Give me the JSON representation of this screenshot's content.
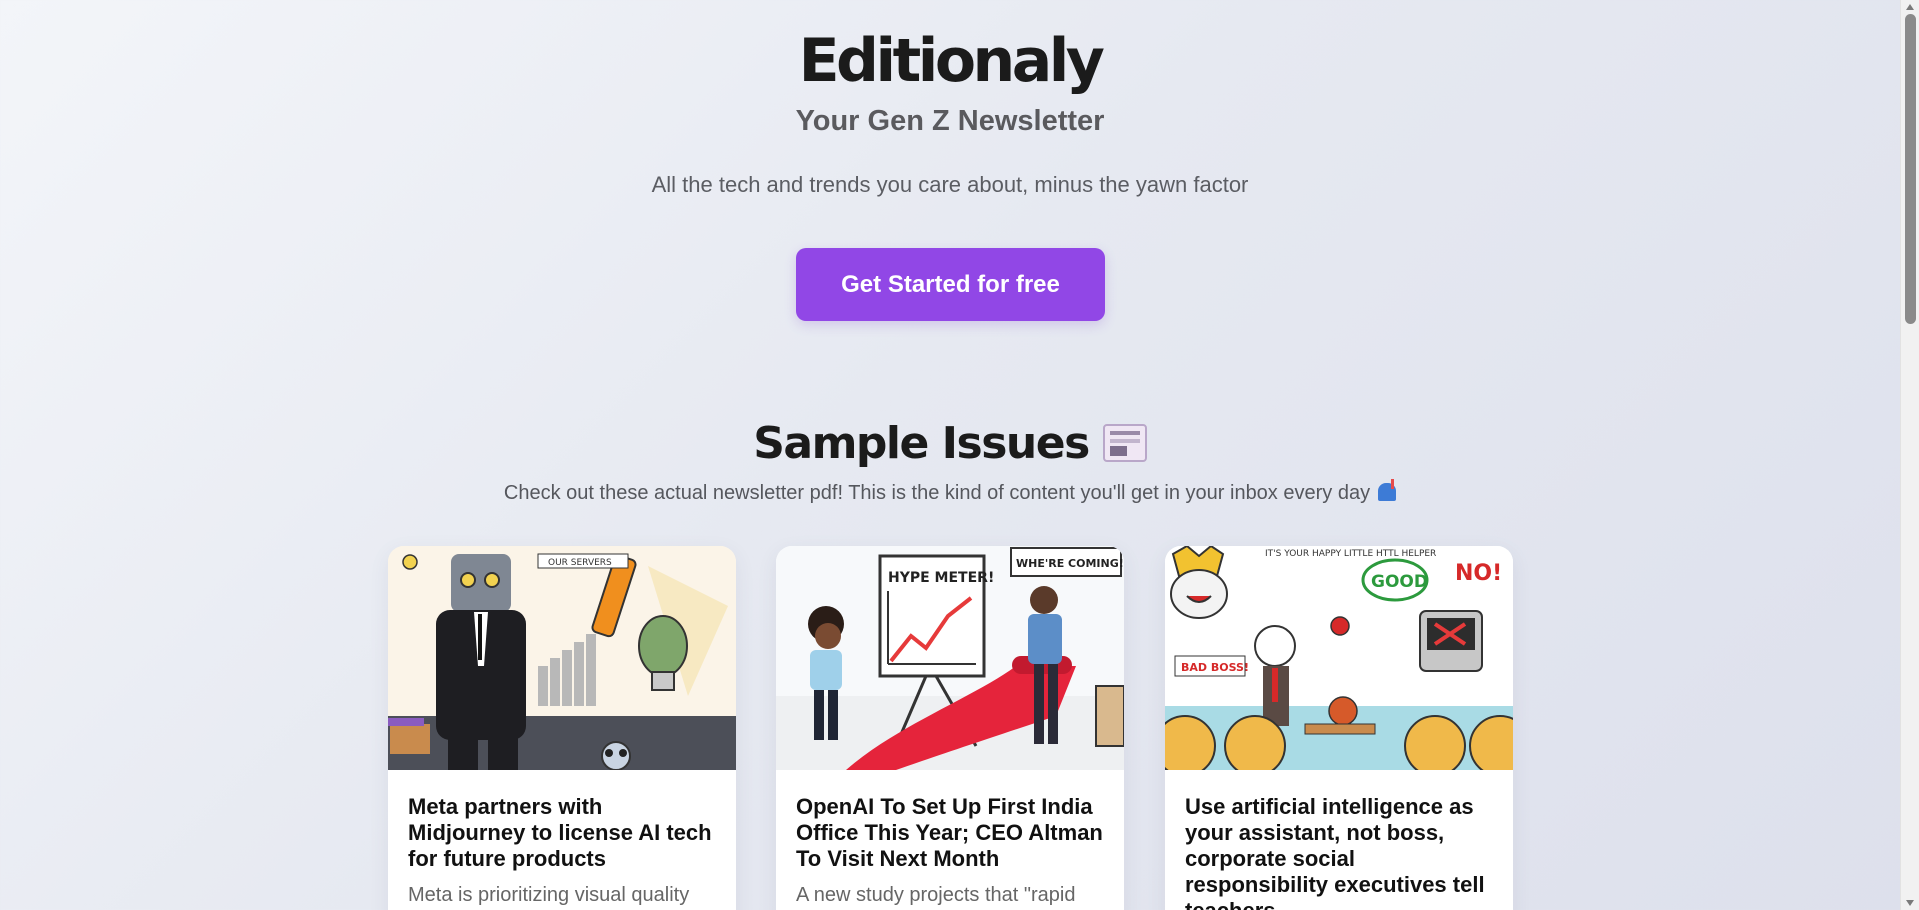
{
  "header": {
    "brand": "Editionaly",
    "tagline": "Your Gen Z Newsletter",
    "subtitle": "All the tech and trends you care about, minus the yawn factor",
    "cta_label": "Get Started for free"
  },
  "samples": {
    "title": "Sample Issues",
    "title_icon": "newspaper-icon",
    "subtitle": "Check out these actual newsletter pdf! This is the kind of content you'll get in your inbox every day",
    "subtitle_icon": "mailbox-icon"
  },
  "cards": [
    {
      "title": "Meta partners with Midjourney to license AI tech for future products",
      "excerpt": "Meta is prioritizing visual quality",
      "image_icon": "robot-businessman-illustration",
      "image_texts": [
        "OUR SERVERS"
      ]
    },
    {
      "title": "OpenAI To Set Up First India Office This Year; CEO Altman To Visit Next Month",
      "excerpt": "A new study projects that \"rapid",
      "image_icon": "hype-meter-illustration",
      "image_texts": [
        "HYPE METER!",
        "WHE'RE COMING!"
      ]
    },
    {
      "title": "Use artificial intelligence as your assistant, not boss, corporate social responsibility executives tell teachers",
      "excerpt": "",
      "image_icon": "ai-helper-classroom-illustration",
      "image_texts": [
        "IT'S YOUR HAPPY LITTLE HTTL HELPER",
        "GOOD",
        "NO!",
        "BAD BOSS!"
      ]
    }
  ],
  "colors": {
    "accent": "#9147e6",
    "background": "#e8ebf2"
  }
}
